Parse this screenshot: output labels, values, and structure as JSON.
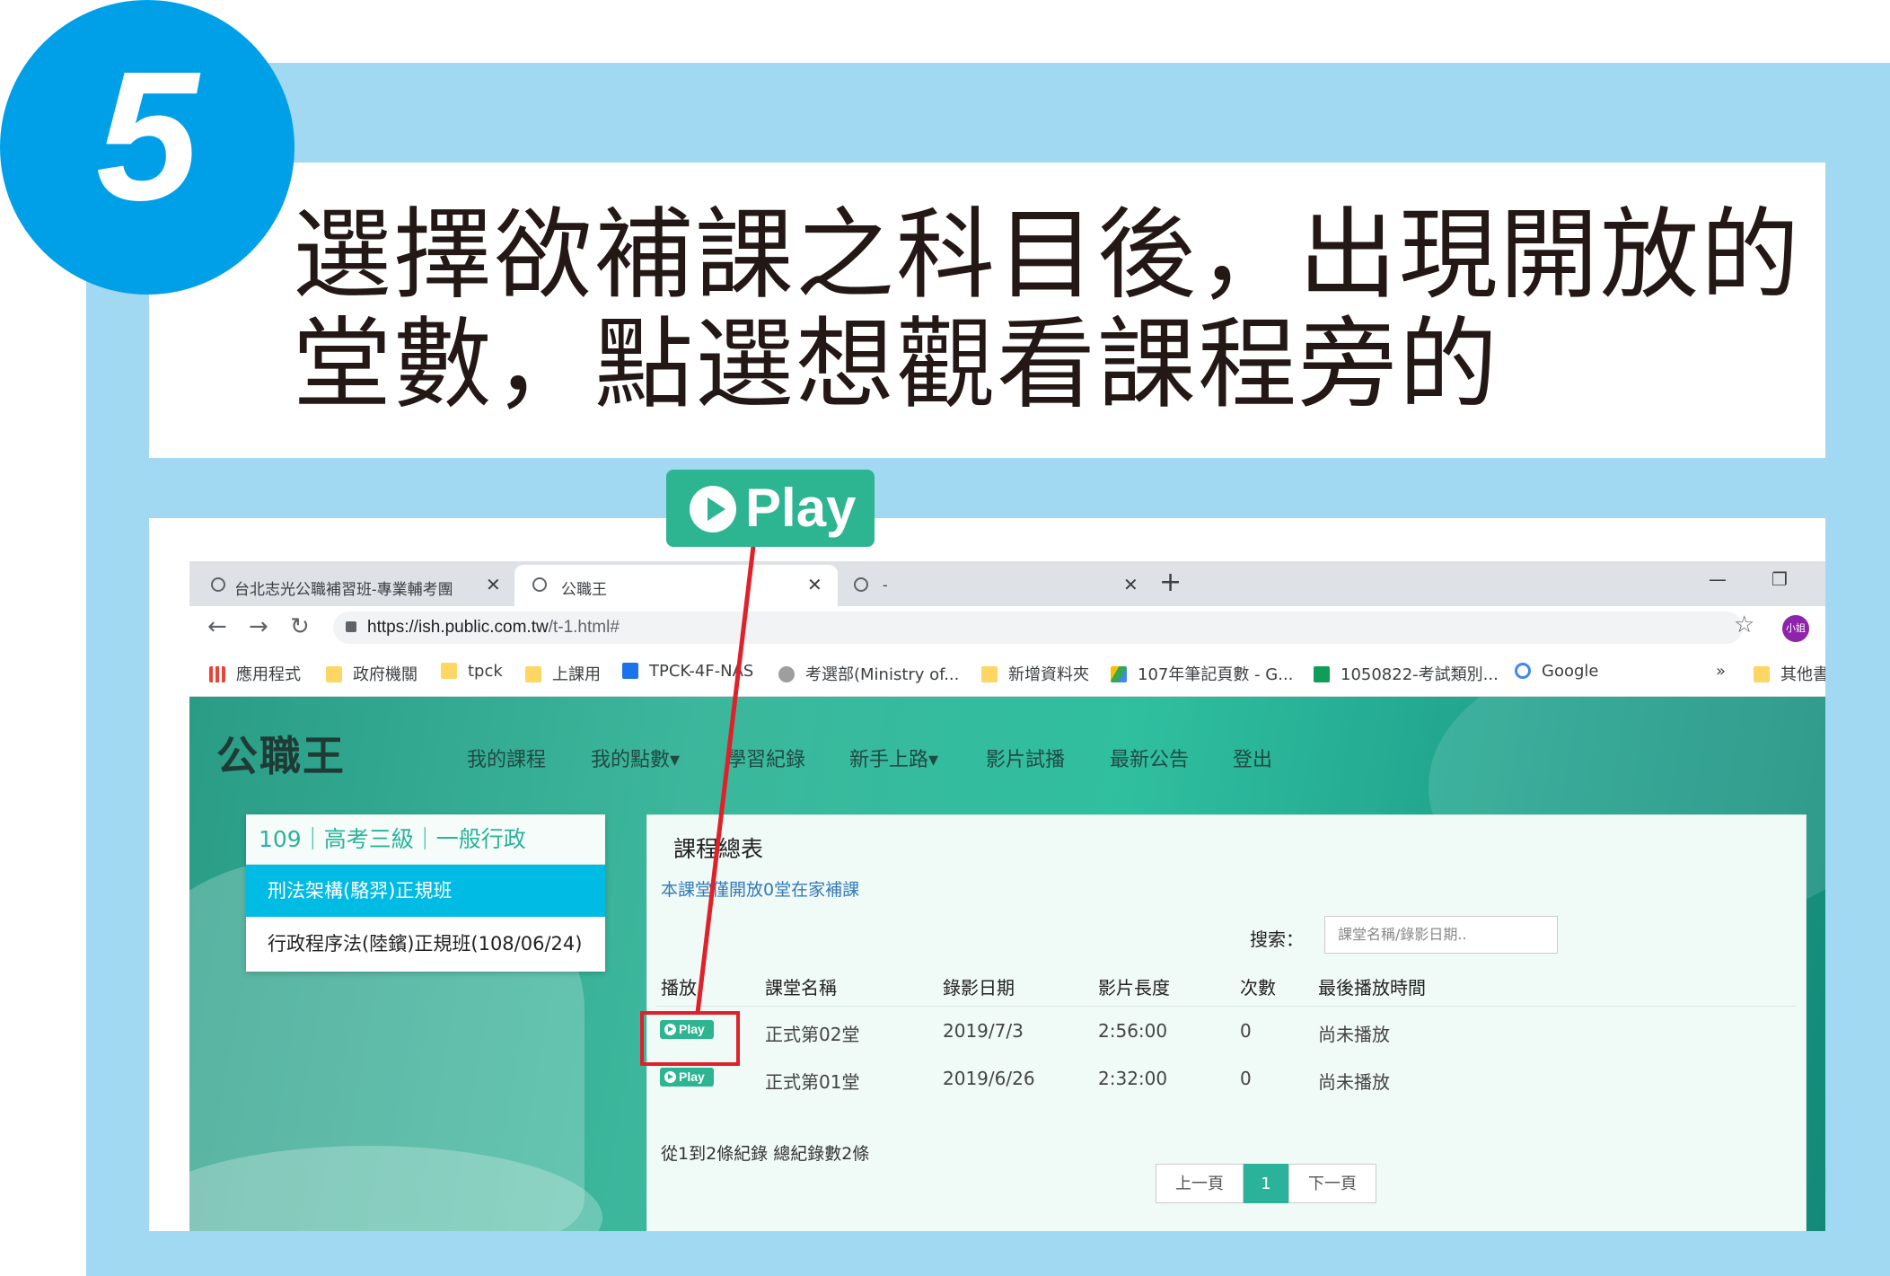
{
  "step": {
    "number": "5"
  },
  "instruction": {
    "line1": "選擇欲補課之科目後，出現開放的",
    "line2": "堂數，點選想觀看課程旁的"
  },
  "callout": {
    "label": "Play"
  },
  "browser": {
    "tabs": [
      {
        "title": "台北志光公職補習班-專業輔考團",
        "close": "✕"
      },
      {
        "title": "公職王",
        "close": "✕"
      },
      {
        "title": "-",
        "close": "✕"
      }
    ],
    "new_tab": "+",
    "window_controls": {
      "minimize": "—",
      "restore": "❐"
    },
    "nav": {
      "back": "←",
      "forward": "→",
      "reload": "↻"
    },
    "url_host": "https://ish.public.com.tw",
    "url_path": "/t-1.html#",
    "profile_label": "小姐",
    "bookmarks": [
      {
        "label": "應用程式",
        "icon": "apps-grid-icon"
      },
      {
        "label": "政府機關",
        "icon": "folder-icon"
      },
      {
        "label": "tpck",
        "icon": "folder-icon"
      },
      {
        "label": "上課用",
        "icon": "folder-icon"
      },
      {
        "label": "TPCK-4F-NAS",
        "icon": "nas-icon"
      },
      {
        "label": "考選部(Ministry of...",
        "icon": "site-icon"
      },
      {
        "label": "新增資料夾",
        "icon": "folder-icon"
      },
      {
        "label": "107年筆記頁數 - G...",
        "icon": "drive-icon"
      },
      {
        "label": "1050822-考試類別...",
        "icon": "sheets-icon"
      },
      {
        "label": "Google",
        "icon": "google-icon"
      }
    ],
    "bookmarks_overflow": "»",
    "other_bookmarks": "其他書"
  },
  "site": {
    "logo": "公職王",
    "nav": [
      "我的課程",
      "我的點數▾",
      "學習紀錄",
      "新手上路▾",
      "影片試播",
      "最新公告",
      "登出"
    ],
    "sidebar": {
      "header": "109｜高考三級｜一般行政",
      "items": [
        "刑法架構(駱羿)正規班",
        "行政程序法(陸鑌)正規班(108/06/24)"
      ]
    },
    "panel": {
      "title": "課程總表",
      "subtitle": "本課堂僅開放0堂在家補課",
      "search_label": "搜索：",
      "search_placeholder": "課堂名稱/錄影日期..",
      "columns": [
        "播放",
        "課堂名稱",
        "錄影日期",
        "影片長度",
        "次數",
        "最後播放時間"
      ],
      "rows": [
        {
          "play": "Play",
          "name": "正式第02堂",
          "date": "2019/7/3",
          "length": "2:56:00",
          "count": "0",
          "last": "尚未播放"
        },
        {
          "play": "Play",
          "name": "正式第01堂",
          "date": "2019/6/26",
          "length": "2:32:00",
          "count": "0",
          "last": "尚未播放"
        }
      ],
      "records": "從1到2條紀錄  總紀錄數2條",
      "pager": {
        "prev": "上一頁",
        "current": "1",
        "next": "下一頁"
      }
    }
  },
  "colors": {
    "frame_blue": "#a1d9f3",
    "step_blue": "#00a0e9",
    "play_green": "#2db491",
    "highlight_red": "#e0202a",
    "sidebar_active": "#00bce4"
  }
}
